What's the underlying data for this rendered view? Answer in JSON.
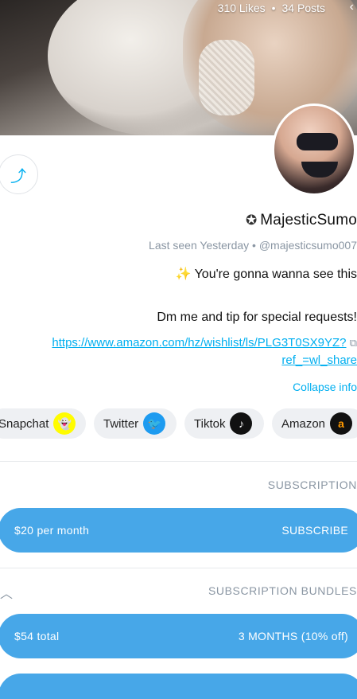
{
  "header": {
    "posts": "34 Posts",
    "separator": "•",
    "likes": "310 Likes"
  },
  "profile": {
    "name": "MajesticSumo",
    "handle": "@majesticsumo007",
    "dot": "•",
    "last_seen": "Last seen Yesterday",
    "bio_line1": "You're gonna wanna see this",
    "bio_emoji": "✨",
    "bio_line2": "Dm me and tip for special requests!",
    "link_line1": "https://www.amazon.com/hz/wishlist/ls/PLG3T0SX9YZ?",
    "link_line2": "ref_=wl_share",
    "collapse": "Collapse info"
  },
  "socials": [
    {
      "label": "Amazon",
      "icon": "a"
    },
    {
      "label": "Tiktok",
      "icon": "♪"
    },
    {
      "label": "Twitter",
      "icon": "🐦"
    },
    {
      "label": "Snapchat",
      "icon": "👻"
    }
  ],
  "subscription": {
    "title": "SUBSCRIPTION",
    "button_label": "SUBSCRIBE",
    "button_price": "$20 per month"
  },
  "bundles": {
    "title": "SUBSCRIPTION BUNDLES",
    "items": [
      {
        "label": "3 MONTHS (10% off)",
        "price": "$54 total"
      }
    ]
  },
  "colors": {
    "accent": "#00aff0",
    "button": "#47a7e8",
    "muted": "#8a96a3"
  }
}
